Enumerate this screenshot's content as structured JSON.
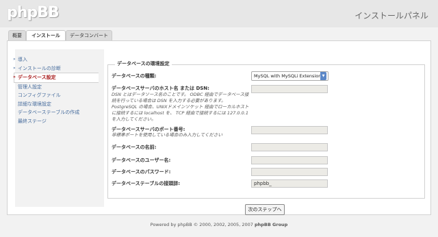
{
  "header": {
    "logo": "phpBB",
    "panel_title": "インストールパネル"
  },
  "tabs": [
    {
      "label": "概要",
      "active": false
    },
    {
      "label": "インストール",
      "active": true
    },
    {
      "label": "データコンバート",
      "active": false
    }
  ],
  "sidebar": {
    "items": [
      {
        "label": "導入",
        "arrow": "»"
      },
      {
        "label": "インストールの診断",
        "arrow": "»"
      },
      {
        "label": "データベース設定",
        "arrow": "»",
        "active": true
      },
      {
        "label": "管理人設定"
      },
      {
        "label": "コンフィグファイル"
      },
      {
        "label": "詳細な環境設定"
      },
      {
        "label": "データベーステーブルの作成"
      },
      {
        "label": "最終ステージ"
      }
    ]
  },
  "form": {
    "legend": "データベースの環境設定",
    "dbms": {
      "label": "データベースの種類:",
      "value": "MySQL with MySQLi Extension"
    },
    "dbhost": {
      "label": "データベースサーバのホスト名 または DSN:",
      "description": "DSN とはデータソース名のことです。 ODBC 経由でデータベース接続を行っている場合は DSN を入力する必要があります。 PostgreSQL の場合、UNIXドメインソケット 経由でローカルホストに接続するには localhost を、 TCP 経由で接続するには 127.0.0.1 を入力してください。",
      "value": ""
    },
    "dbport": {
      "label": "データベースサーバのポート番号:",
      "description": "非標準ポートを使用している場合のみ入力してください",
      "value": ""
    },
    "dbname": {
      "label": "データベースの名前:",
      "value": ""
    },
    "dbuser": {
      "label": "データベースのユーザー名:",
      "value": ""
    },
    "dbpasswd": {
      "label": "データベースのパスワード:",
      "value": ""
    },
    "table_prefix": {
      "label": "データベーステーブルの接頭辞:",
      "value": "phpbb_"
    }
  },
  "next_button": "次のステップへ",
  "footer": {
    "prefix": "Powered by phpBB © 2000, 2002, 2005, 2007 ",
    "group": "phpBB Group"
  }
}
